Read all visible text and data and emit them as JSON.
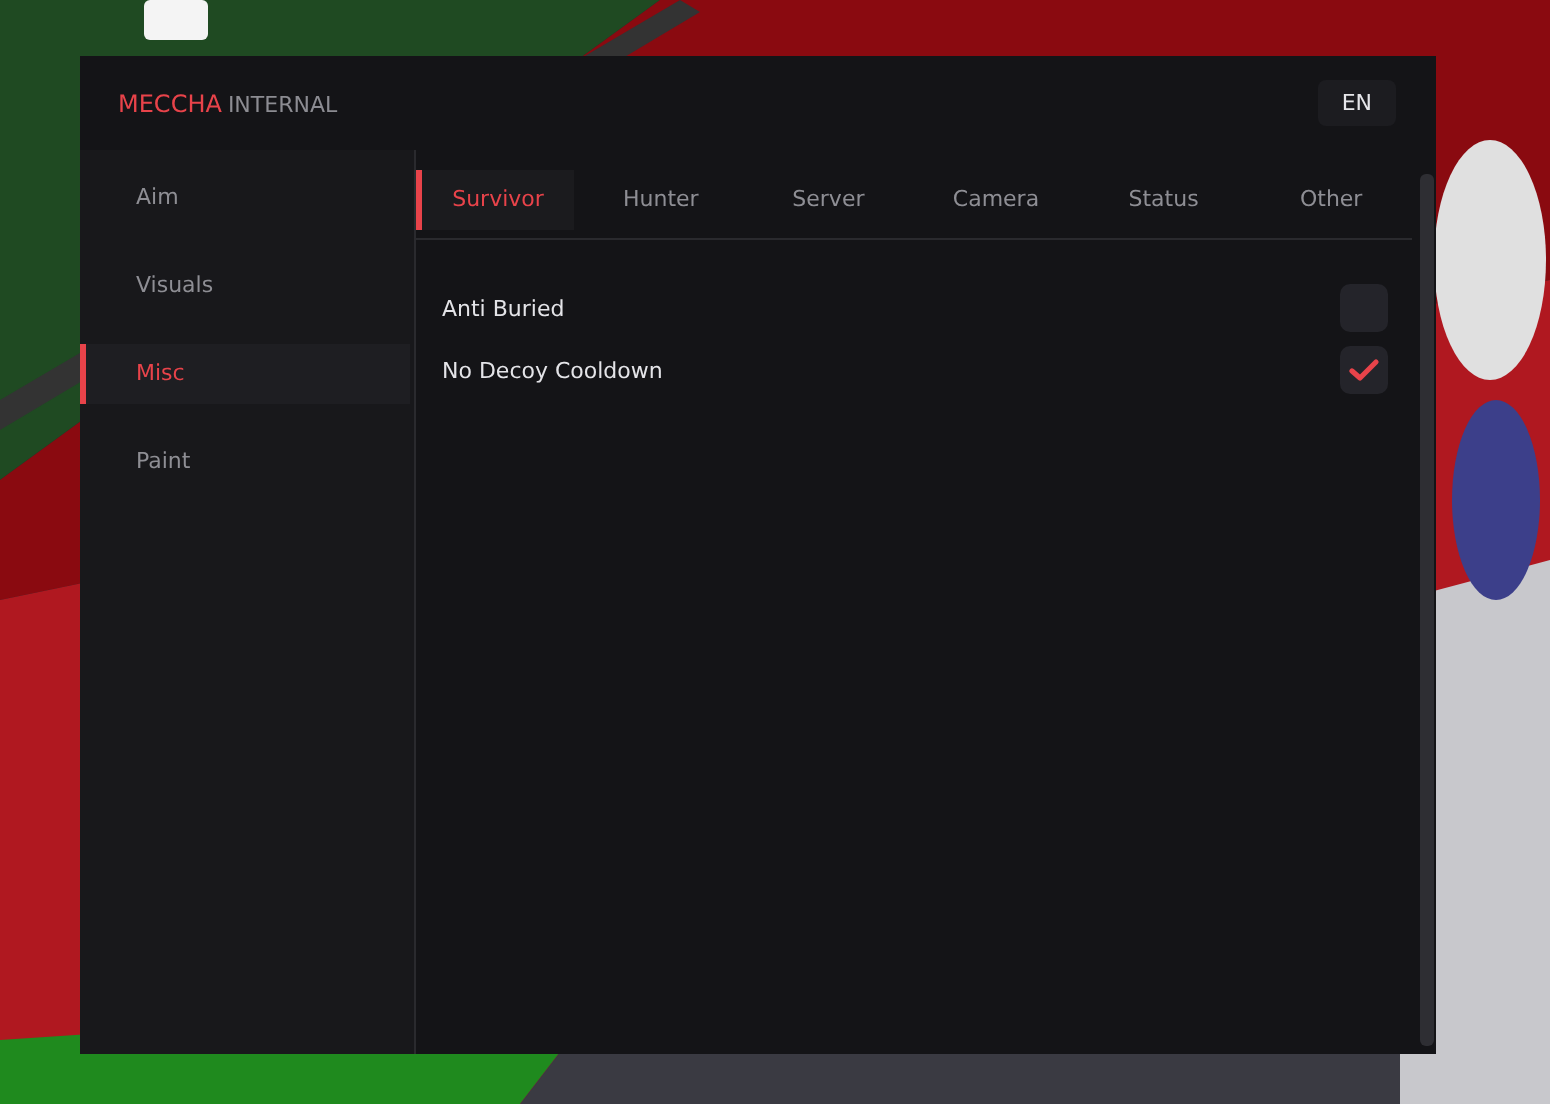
{
  "window": {
    "brand": "MECCHA",
    "title": "INTERNAL",
    "language": "EN"
  },
  "sidebar": {
    "items": [
      {
        "label": "Aim",
        "selected": false
      },
      {
        "label": "Visuals",
        "selected": false
      },
      {
        "label": "Misc",
        "selected": true
      },
      {
        "label": "Paint",
        "selected": false
      }
    ]
  },
  "tabs": [
    {
      "label": "Survivor",
      "selected": true
    },
    {
      "label": "Hunter",
      "selected": false
    },
    {
      "label": "Server",
      "selected": false
    },
    {
      "label": "Camera",
      "selected": false
    },
    {
      "label": "Status",
      "selected": false
    },
    {
      "label": "Other",
      "selected": false
    }
  ],
  "options": [
    {
      "label": "Anti Buried",
      "checked": false
    },
    {
      "label": "No Decoy Cooldown",
      "checked": true
    }
  ]
}
